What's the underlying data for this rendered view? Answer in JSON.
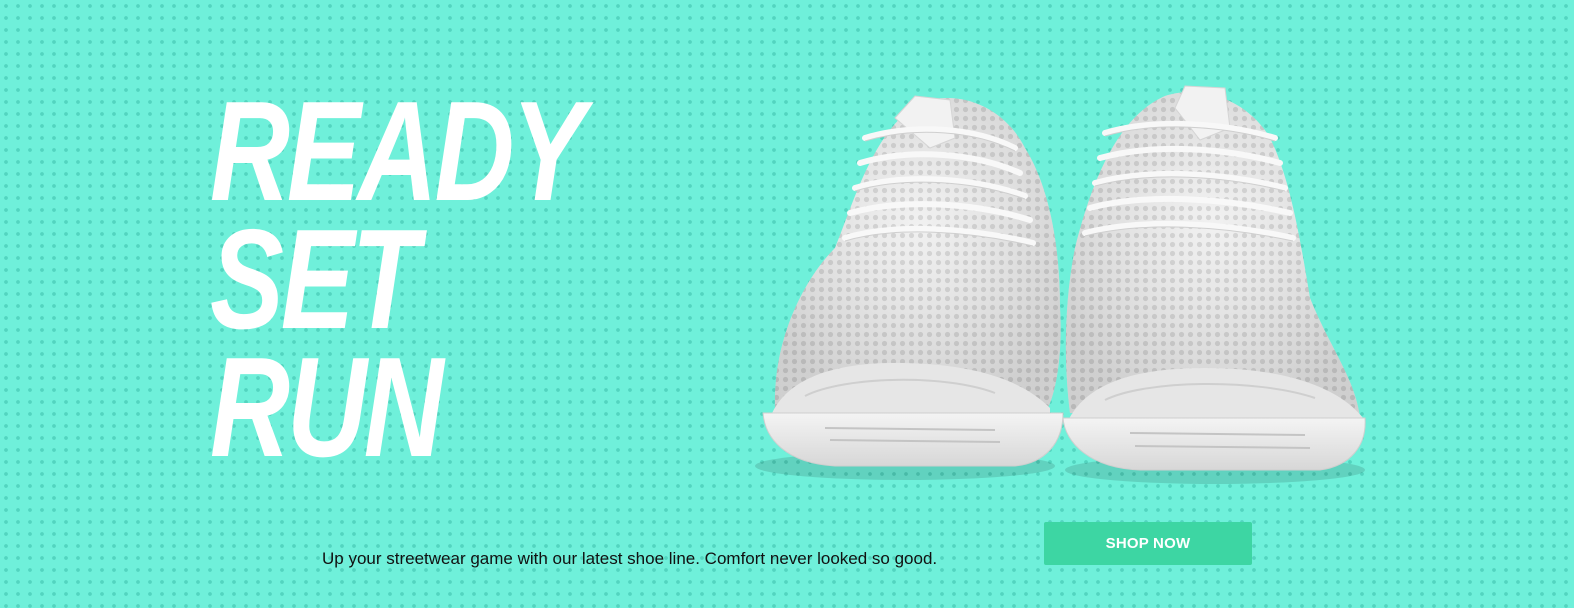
{
  "hero": {
    "headline": [
      "READY",
      "SET",
      "RUN"
    ],
    "tagline": "Up your streetwear game with our latest shoe line. Comfort never looked so good.",
    "cta_label": "SHOP NOW",
    "image": "white-mesh-sneakers-pair"
  },
  "colors": {
    "background": "#6ff0da",
    "dots": "#3cbeaa",
    "headline": "#ffffff",
    "button": "#3dd6a3",
    "button_text": "#ffffff",
    "text": "#111111"
  }
}
